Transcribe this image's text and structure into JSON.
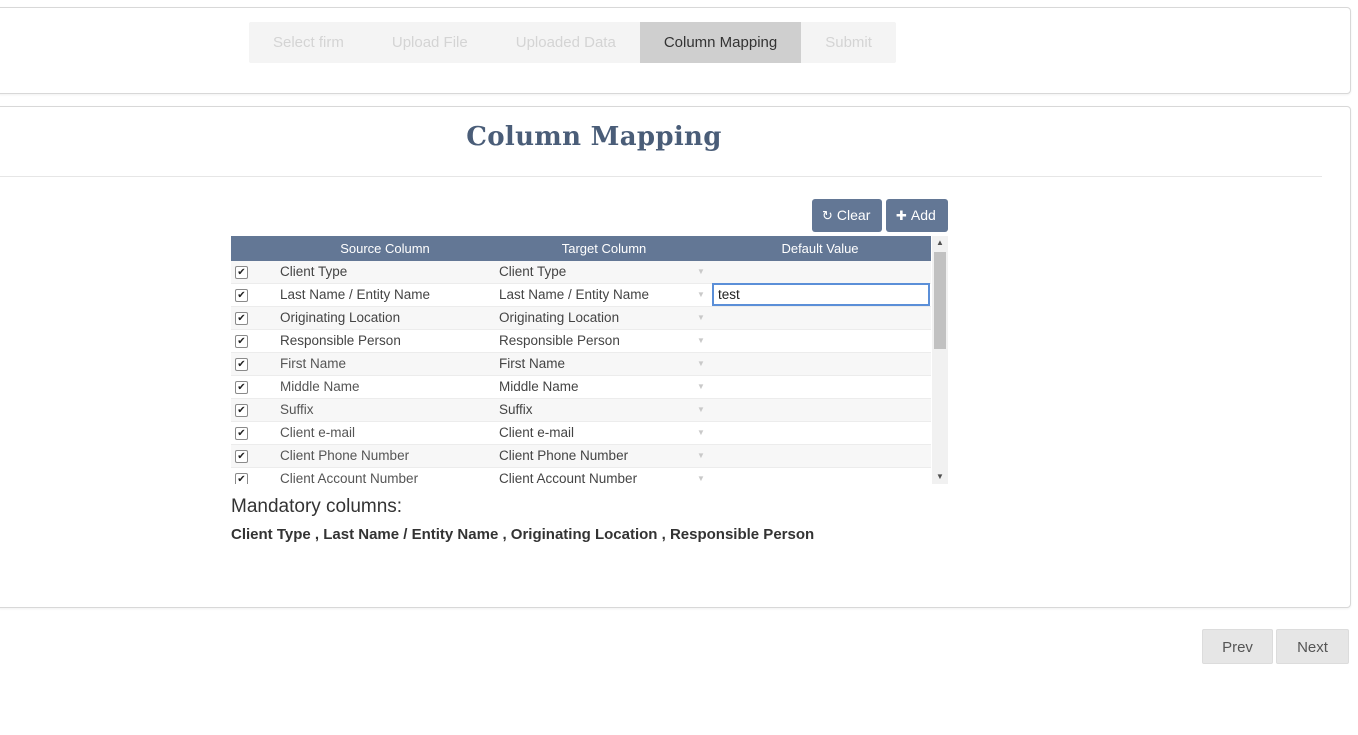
{
  "wizard": {
    "steps": [
      {
        "label": "Select firm",
        "active": false
      },
      {
        "label": "Upload File",
        "active": false
      },
      {
        "label": "Uploaded Data",
        "active": false
      },
      {
        "label": "Column Mapping",
        "active": true
      },
      {
        "label": "Submit",
        "active": false
      }
    ]
  },
  "page": {
    "title": "Column Mapping"
  },
  "toolbar": {
    "clear_label": "Clear",
    "clear_icon": "refresh-icon",
    "add_label": "Add",
    "add_icon": "plus-icon"
  },
  "grid": {
    "columns": [
      "Source Column",
      "Target Column",
      "Default Value"
    ],
    "rows": [
      {
        "checked": true,
        "source": "Client Type",
        "target": "Client Type",
        "default": ""
      },
      {
        "checked": true,
        "source": "Last Name / Entity Name",
        "target": "Last Name / Entity Name",
        "default": "test",
        "editing": true
      },
      {
        "checked": true,
        "source": "Originating Location",
        "target": "Originating Location",
        "default": ""
      },
      {
        "checked": true,
        "source": "Responsible Person",
        "target": "Responsible Person",
        "default": ""
      },
      {
        "checked": true,
        "source": "First Name",
        "target": "First Name",
        "default": ""
      },
      {
        "checked": true,
        "source": "Middle Name",
        "target": "Middle Name",
        "default": ""
      },
      {
        "checked": true,
        "source": "Suffix",
        "target": "Suffix",
        "default": ""
      },
      {
        "checked": true,
        "source": "Client e-mail",
        "target": "Client e-mail",
        "default": ""
      },
      {
        "checked": true,
        "source": "Client Phone Number",
        "target": "Client Phone Number",
        "default": ""
      },
      {
        "checked": true,
        "source": "Client Account Number",
        "target": "Client Account Number",
        "default": ""
      }
    ]
  },
  "mandatory": {
    "title": "Mandatory columns:",
    "list": "Client Type , Last Name / Entity Name , Originating Location , Responsible Person"
  },
  "nav": {
    "prev_label": "Prev",
    "next_label": "Next"
  },
  "colors": {
    "accent": "#637795",
    "title": "#4a5d78",
    "active_step": "#cfcfcf",
    "edit_border": "#5b8fd8"
  }
}
